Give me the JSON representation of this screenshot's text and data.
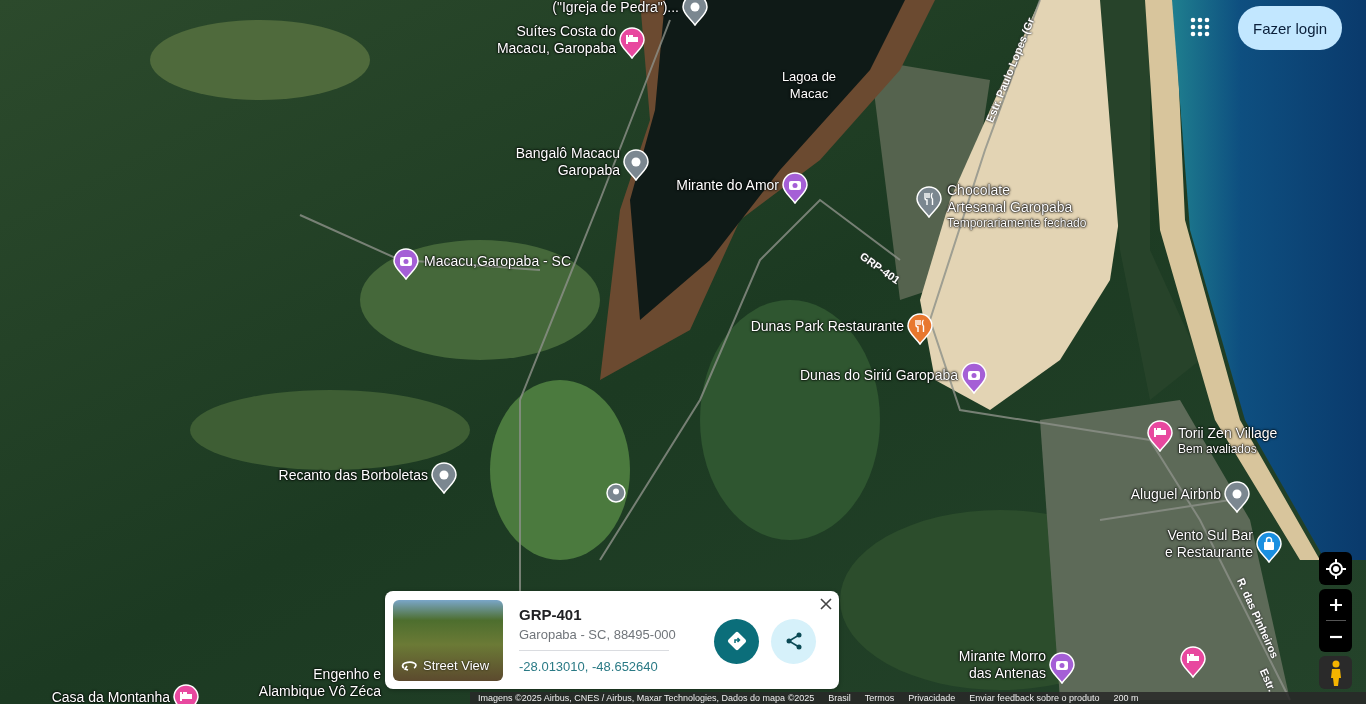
{
  "header": {
    "login_button": "Fazer login"
  },
  "places": [
    {
      "kind": "pin",
      "lines": [
        "(\"Igreja de Pedra\")..."
      ]
    },
    {
      "kind": "hotel",
      "lines": [
        "Suítes Costa do",
        "Macacu, Garopaba"
      ]
    },
    {
      "kind": "water",
      "lines": [
        "Lagoa de",
        "Macac"
      ]
    },
    {
      "kind": "pin",
      "lines": [
        "Bangalô Macacu",
        "Garopaba"
      ]
    },
    {
      "kind": "camera",
      "lines": [
        "Mirante do Amor"
      ]
    },
    {
      "kind": "dining",
      "lines": [
        "Chocolate",
        "Artesanal Garopaba"
      ],
      "note": "Temporariamente fechado"
    },
    {
      "kind": "camera",
      "lines": [
        "Macacu,Garopaba - SC"
      ]
    },
    {
      "kind": "restaurant",
      "lines": [
        "Dunas Park Restaurante"
      ]
    },
    {
      "kind": "camera",
      "lines": [
        "Dunas do Siriú Garopaba"
      ]
    },
    {
      "kind": "hotel",
      "lines": [
        "Torii Zen Village"
      ],
      "note": "Bem avaliados"
    },
    {
      "kind": "pin",
      "lines": [
        "Recanto das Borboletas"
      ]
    },
    {
      "kind": "pin",
      "lines": [
        "Aluguel Airbnb"
      ]
    },
    {
      "kind": "shop",
      "lines": [
        "Vento Sul Bar",
        "e Restaurante"
      ]
    },
    {
      "kind": "camera",
      "lines": [
        "Mirante Morro",
        "das Antenas"
      ]
    },
    {
      "kind": "hotel"
    },
    {
      "kind": "hotel",
      "lines": [
        "Casa da Montanha"
      ]
    },
    {
      "kind": "text",
      "lines": [
        "Engenho e",
        "Alambique Vô Zéca"
      ]
    },
    {
      "kind": "dot"
    }
  ],
  "road_labels": [
    "Estr. Paulo Lopes (Gr",
    "GRP-401",
    "R. das Pinheiros",
    "Estr."
  ],
  "place_card": {
    "thumbnail_label": "Street View",
    "title": "GRP-401",
    "address": "Garopaba - SC, 88495-000",
    "coordinates": "-28.013010, -48.652640"
  },
  "footer": {
    "attribution": "Imagens ©2025 Airbus, CNES / Airbus, Maxar Technologies, Dados do mapa ©2025",
    "links": [
      "Brasil",
      "Termos",
      "Privacidade",
      "Enviar feedback sobre o produto"
    ],
    "scale": "200 m"
  }
}
